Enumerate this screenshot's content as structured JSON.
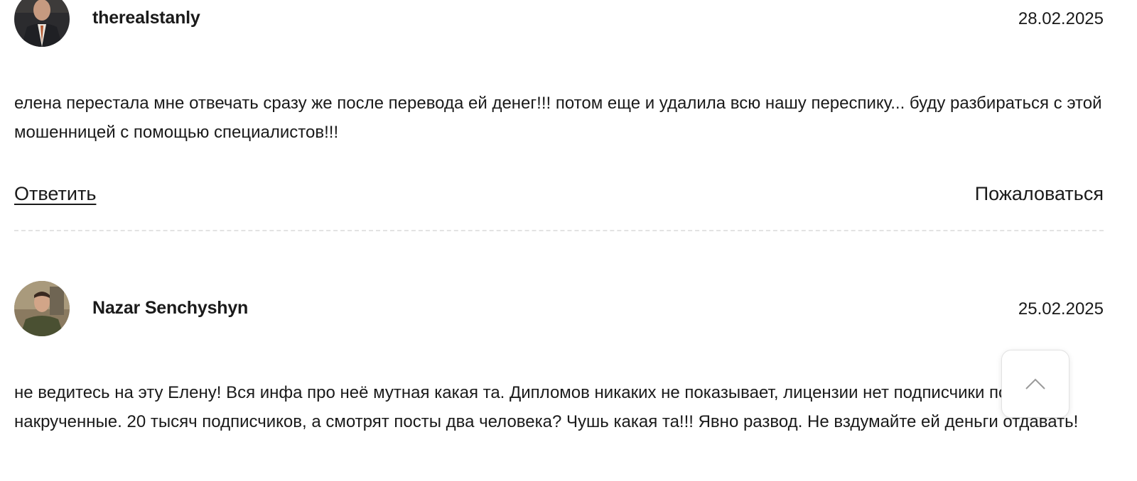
{
  "comments": [
    {
      "author": "therealstanly",
      "date": "28.02.2025",
      "text": "елена перестала мне отвечать сразу же после перевода ей денег!!! потом еще и удалила всю нашу переспику... буду разбираться с этой мошенницей с помощью специалистов!!!",
      "reply_label": "Ответить",
      "report_label": "Пожаловаться"
    },
    {
      "author": "Nazar Senchyshyn",
      "date": "25.02.2025",
      "text": "не ведитесь на эту Елену! Вся инфа про неё мутная какая та. Дипломов никаких не показывает, лицензии нет подписчики похоже накрученные. 20 тысяч подписчиков, а смотрят посты два человека? Чушь какая та!!! Явно развод. Не вздумайте ей деньги отдавать!"
    }
  ],
  "scroll_top": {
    "icon": "chevron-up-icon"
  },
  "colors": {
    "text": "#1a1a1a",
    "divider": "#e3e3e3"
  }
}
